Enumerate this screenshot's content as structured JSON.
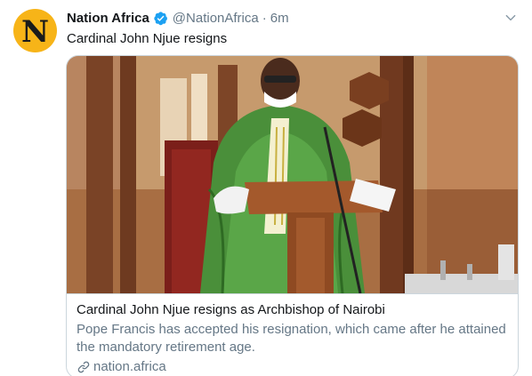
{
  "tweet": {
    "avatar_letter": "N",
    "display_name": "Nation Africa",
    "handle": "@NationAfrica",
    "separator": "·",
    "time": "6m",
    "text": "Cardinal John Njue resigns"
  },
  "card": {
    "image_subject": "Cardinal in green vestments speaking at a wooden lectern in a church",
    "title": "Cardinal John Njue resigns as Archbishop of Nairobi",
    "description": "Pope Francis has accepted his resignation, which came after he attained the mandatory retirement age.",
    "domain": "nation.africa"
  },
  "icons": {
    "verified": "verified-badge-icon",
    "more": "chevron-down-icon",
    "link": "link-icon"
  },
  "colors": {
    "avatar": "#f7b418",
    "verified": "#1da1f2",
    "secondary_text": "#657786",
    "border": "#ccd6dd"
  }
}
